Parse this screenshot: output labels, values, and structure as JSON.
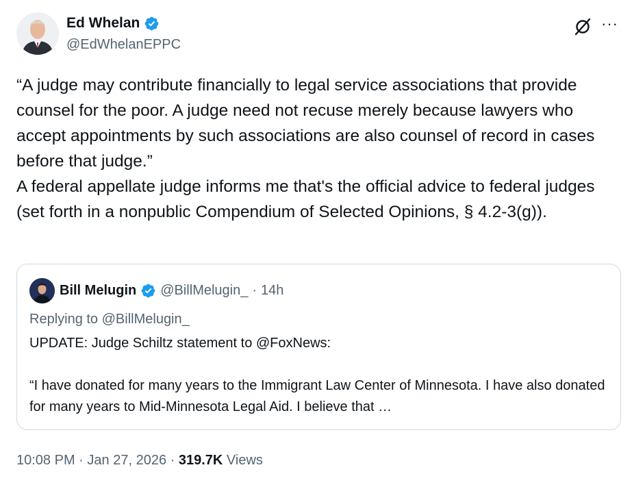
{
  "author": {
    "name": "Ed Whelan",
    "handle": "@EdWhelanEPPC",
    "verified_color": "#1d9bf0"
  },
  "tweet": {
    "text": "“A judge may contribute financially to legal service associations that provide counsel for the poor. A judge need not recuse merely because lawyers who accept appointments by such associations are also counsel of record in cases before that judge.”\nA federal appellate judge informs me that's the official advice to federal judges (set forth in a nonpublic Compendium of Selected Opinions, § 4.2-3(g))."
  },
  "quoted_tweet": {
    "name": "Bill Melugin",
    "handle": "@BillMelugin_",
    "separator": "·",
    "time": "14h",
    "replying_to": "Replying to @BillMelugin_",
    "text": "UPDATE: Judge Schiltz statement to @FoxNews:\n\n“I have donated for many years to the Immigrant Law Center of Minnesota.  I have also donated for many years to Mid-Minnesota Legal Aid.  I believe that …"
  },
  "meta": {
    "time": "10:08 PM",
    "separator": "·",
    "date": "Jan 27, 2026",
    "views_count": "319.7K",
    "views_label": "Views"
  },
  "icons": {
    "grok": "grok-icon",
    "more": "more-options-icon",
    "verified": "verified-badge-icon"
  }
}
